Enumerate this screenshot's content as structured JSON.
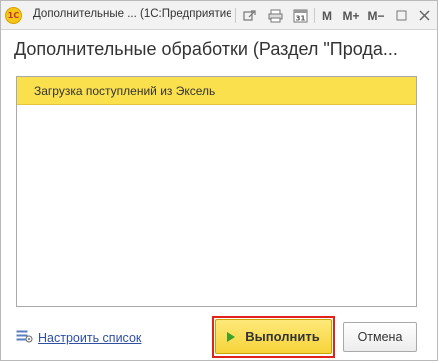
{
  "window": {
    "logo_text": "1С",
    "title": "Дополнительные ... (1С:Предприятие)",
    "toolbar": {
      "m_label": "M",
      "m_plus_label": "M+",
      "m_minus_label": "M−",
      "calendar_day": "31"
    }
  },
  "form": {
    "title": "Дополнительные обработки (Раздел \"Прода..."
  },
  "list": {
    "items": [
      {
        "label": "Загрузка поступлений из Эксель"
      }
    ]
  },
  "footer": {
    "configure_label": "Настроить список",
    "run_label": "Выполнить",
    "cancel_label": "Отмена"
  },
  "colors": {
    "selection": "#fbe04d",
    "accent_button": "#f8d43a",
    "highlight_frame": "#e2231a",
    "link": "#2f4fa2"
  }
}
